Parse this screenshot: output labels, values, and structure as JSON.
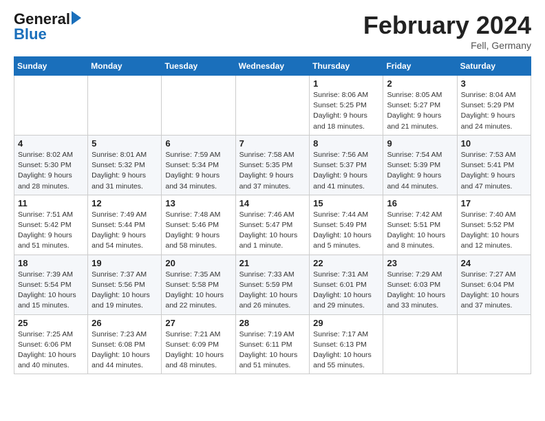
{
  "header": {
    "logo_line1": "General",
    "logo_line2": "Blue",
    "month_title": "February 2024",
    "location": "Fell, Germany"
  },
  "weekdays": [
    "Sunday",
    "Monday",
    "Tuesday",
    "Wednesday",
    "Thursday",
    "Friday",
    "Saturday"
  ],
  "weeks": [
    [
      {
        "day": "",
        "info": ""
      },
      {
        "day": "",
        "info": ""
      },
      {
        "day": "",
        "info": ""
      },
      {
        "day": "",
        "info": ""
      },
      {
        "day": "1",
        "info": "Sunrise: 8:06 AM\nSunset: 5:25 PM\nDaylight: 9 hours\nand 18 minutes."
      },
      {
        "day": "2",
        "info": "Sunrise: 8:05 AM\nSunset: 5:27 PM\nDaylight: 9 hours\nand 21 minutes."
      },
      {
        "day": "3",
        "info": "Sunrise: 8:04 AM\nSunset: 5:29 PM\nDaylight: 9 hours\nand 24 minutes."
      }
    ],
    [
      {
        "day": "4",
        "info": "Sunrise: 8:02 AM\nSunset: 5:30 PM\nDaylight: 9 hours\nand 28 minutes."
      },
      {
        "day": "5",
        "info": "Sunrise: 8:01 AM\nSunset: 5:32 PM\nDaylight: 9 hours\nand 31 minutes."
      },
      {
        "day": "6",
        "info": "Sunrise: 7:59 AM\nSunset: 5:34 PM\nDaylight: 9 hours\nand 34 minutes."
      },
      {
        "day": "7",
        "info": "Sunrise: 7:58 AM\nSunset: 5:35 PM\nDaylight: 9 hours\nand 37 minutes."
      },
      {
        "day": "8",
        "info": "Sunrise: 7:56 AM\nSunset: 5:37 PM\nDaylight: 9 hours\nand 41 minutes."
      },
      {
        "day": "9",
        "info": "Sunrise: 7:54 AM\nSunset: 5:39 PM\nDaylight: 9 hours\nand 44 minutes."
      },
      {
        "day": "10",
        "info": "Sunrise: 7:53 AM\nSunset: 5:41 PM\nDaylight: 9 hours\nand 47 minutes."
      }
    ],
    [
      {
        "day": "11",
        "info": "Sunrise: 7:51 AM\nSunset: 5:42 PM\nDaylight: 9 hours\nand 51 minutes."
      },
      {
        "day": "12",
        "info": "Sunrise: 7:49 AM\nSunset: 5:44 PM\nDaylight: 9 hours\nand 54 minutes."
      },
      {
        "day": "13",
        "info": "Sunrise: 7:48 AM\nSunset: 5:46 PM\nDaylight: 9 hours\nand 58 minutes."
      },
      {
        "day": "14",
        "info": "Sunrise: 7:46 AM\nSunset: 5:47 PM\nDaylight: 10 hours\nand 1 minute."
      },
      {
        "day": "15",
        "info": "Sunrise: 7:44 AM\nSunset: 5:49 PM\nDaylight: 10 hours\nand 5 minutes."
      },
      {
        "day": "16",
        "info": "Sunrise: 7:42 AM\nSunset: 5:51 PM\nDaylight: 10 hours\nand 8 minutes."
      },
      {
        "day": "17",
        "info": "Sunrise: 7:40 AM\nSunset: 5:52 PM\nDaylight: 10 hours\nand 12 minutes."
      }
    ],
    [
      {
        "day": "18",
        "info": "Sunrise: 7:39 AM\nSunset: 5:54 PM\nDaylight: 10 hours\nand 15 minutes."
      },
      {
        "day": "19",
        "info": "Sunrise: 7:37 AM\nSunset: 5:56 PM\nDaylight: 10 hours\nand 19 minutes."
      },
      {
        "day": "20",
        "info": "Sunrise: 7:35 AM\nSunset: 5:58 PM\nDaylight: 10 hours\nand 22 minutes."
      },
      {
        "day": "21",
        "info": "Sunrise: 7:33 AM\nSunset: 5:59 PM\nDaylight: 10 hours\nand 26 minutes."
      },
      {
        "day": "22",
        "info": "Sunrise: 7:31 AM\nSunset: 6:01 PM\nDaylight: 10 hours\nand 29 minutes."
      },
      {
        "day": "23",
        "info": "Sunrise: 7:29 AM\nSunset: 6:03 PM\nDaylight: 10 hours\nand 33 minutes."
      },
      {
        "day": "24",
        "info": "Sunrise: 7:27 AM\nSunset: 6:04 PM\nDaylight: 10 hours\nand 37 minutes."
      }
    ],
    [
      {
        "day": "25",
        "info": "Sunrise: 7:25 AM\nSunset: 6:06 PM\nDaylight: 10 hours\nand 40 minutes."
      },
      {
        "day": "26",
        "info": "Sunrise: 7:23 AM\nSunset: 6:08 PM\nDaylight: 10 hours\nand 44 minutes."
      },
      {
        "day": "27",
        "info": "Sunrise: 7:21 AM\nSunset: 6:09 PM\nDaylight: 10 hours\nand 48 minutes."
      },
      {
        "day": "28",
        "info": "Sunrise: 7:19 AM\nSunset: 6:11 PM\nDaylight: 10 hours\nand 51 minutes."
      },
      {
        "day": "29",
        "info": "Sunrise: 7:17 AM\nSunset: 6:13 PM\nDaylight: 10 hours\nand 55 minutes."
      },
      {
        "day": "",
        "info": ""
      },
      {
        "day": "",
        "info": ""
      }
    ]
  ]
}
